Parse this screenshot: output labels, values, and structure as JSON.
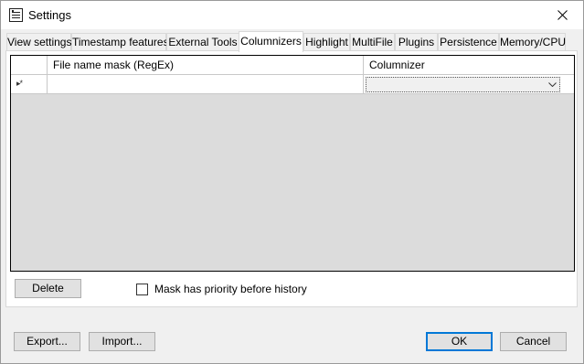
{
  "window": {
    "title": "Settings"
  },
  "tabs": [
    {
      "label": "View settings"
    },
    {
      "label": "Timestamp features"
    },
    {
      "label": "External Tools"
    },
    {
      "label": "Columnizers",
      "active": true
    },
    {
      "label": "Highlight"
    },
    {
      "label": "MultiFile"
    },
    {
      "label": "Plugins"
    },
    {
      "label": "Persistence"
    },
    {
      "label": "Memory/CPU"
    }
  ],
  "grid": {
    "columns": [
      "File name mask (RegEx)",
      "Columnizer"
    ],
    "new_row_marker": "▸*",
    "rows": [
      {
        "mask": "",
        "columnizer": ""
      }
    ]
  },
  "panel": {
    "delete_label": "Delete",
    "mask_priority_label": "Mask has priority before history",
    "mask_priority_checked": false
  },
  "footer": {
    "export_label": "Export...",
    "import_label": "Import...",
    "ok_label": "OK",
    "cancel_label": "Cancel"
  },
  "colors": {
    "accent": "#0078d7",
    "grid_bg": "#dcdcdc"
  }
}
